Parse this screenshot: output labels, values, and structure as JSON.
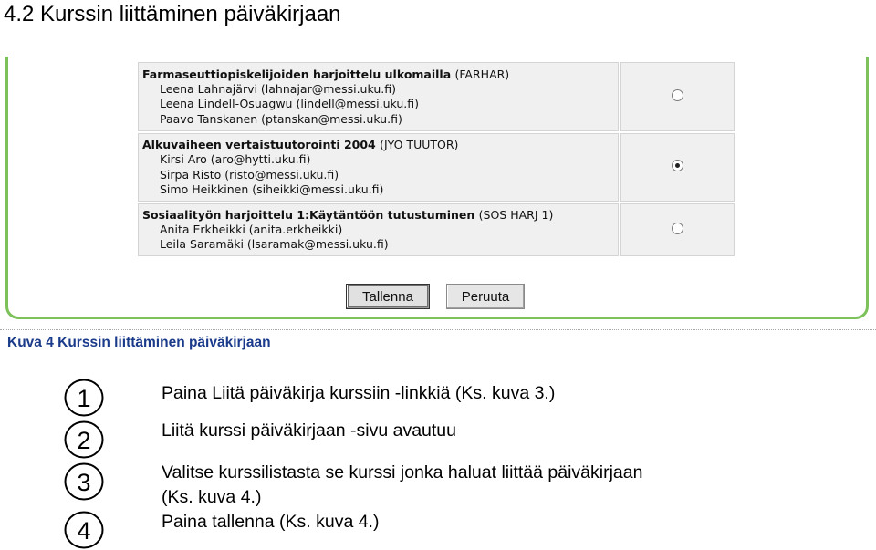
{
  "heading": "4.2 Kurssin liittäminen päiväkirjaan",
  "courses": [
    {
      "title": "Farmaseuttiopiskelijoiden harjoittelu ulkomailla",
      "code": "(FARHAR)",
      "teachers": [
        "Leena Lahnajärvi (lahnajar@messi.uku.fi)",
        "Leena Lindell-Osuagwu (lindell@messi.uku.fi)",
        "Paavo Tanskanen (ptanskan@messi.uku.fi)"
      ],
      "selected": false
    },
    {
      "title": "Alkuvaiheen vertaistuutorointi 2004",
      "code": "(JYO TUUTOR)",
      "teachers": [
        "Kirsi Aro (aro@hytti.uku.fi)",
        "Sirpa Risto (risto@messi.uku.fi)",
        "Simo Heikkinen (siheikki@messi.uku.fi)"
      ],
      "selected": true
    },
    {
      "title": "Sosiaalityön harjoittelu 1:Käytäntöön tutustuminen",
      "code": "(SOS HARJ 1)",
      "teachers": [
        "Anita Erkheikki (anita.erkheikki)",
        "Leila Saramäki (lsaramak@messi.uku.fi)"
      ],
      "selected": false
    }
  ],
  "buttons": {
    "save": "Tallenna",
    "cancel": "Peruuta"
  },
  "caption": "Kuva 4 Kurssin liittäminen päiväkirjaan",
  "steps": [
    {
      "number": "1",
      "text": "Paina Liitä päiväkirja kurssiin -linkkiä (Ks. kuva 3.)"
    },
    {
      "number": "2",
      "text": "Liitä kurssi päiväkirjaan -sivu avautuu"
    },
    {
      "number": "3",
      "text_line1": "Valitse kurssilistasta se kurssi jonka haluat liittää päiväkirjaan",
      "text_line2": "(Ks. kuva 4.)"
    },
    {
      "number": "4",
      "text": "Paina tallenna (Ks. kuva 4.)"
    }
  ]
}
